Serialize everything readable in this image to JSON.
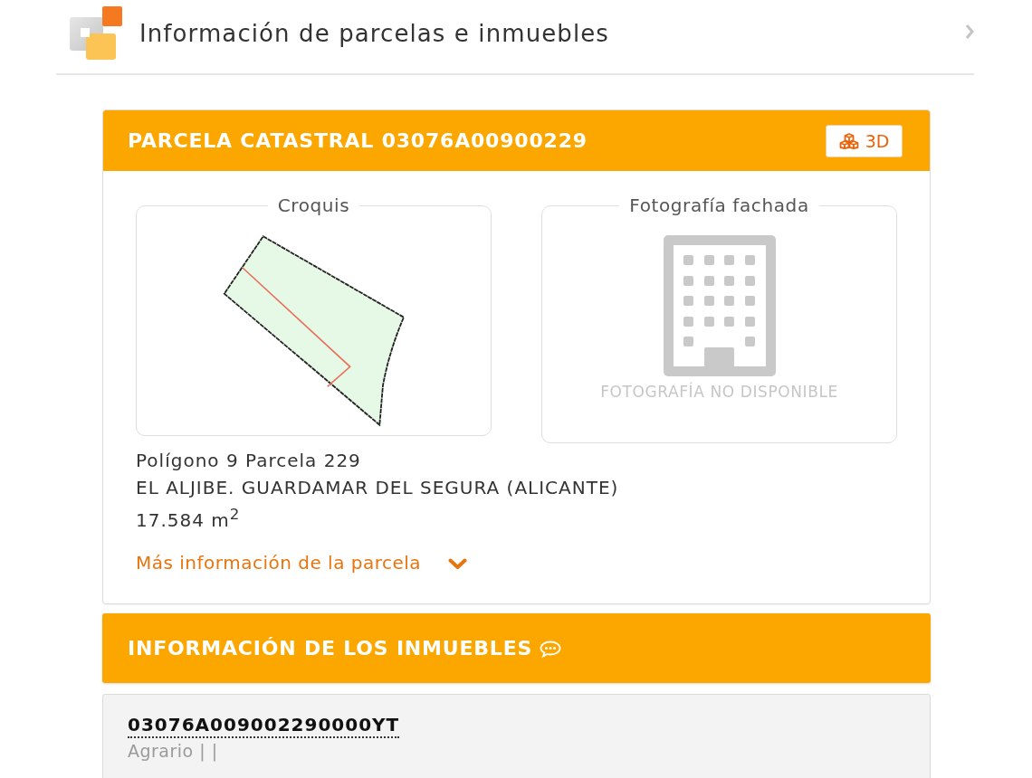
{
  "header": {
    "title": "Información de parcelas e inmuebles"
  },
  "parcel": {
    "title": "PARCELA CATASTRAL 03076A00900229",
    "view_3d_button": "3D",
    "sketch": {
      "legend": "Croquis"
    },
    "facade_photo": {
      "legend": "Fotografía fachada",
      "notice": "FOTOGRAFÍA NO DISPONIBLE"
    },
    "details": [
      "Polígono 9 Parcela 229",
      "EL ALJIBE. GUARDAMAR DEL SEGURA (ALICANTE)",
      "17.584 m$^{2}$"
    ],
    "more_info": {
      "label": "Más información de la parcela",
      "expanded": false
    }
  },
  "properties": {
    "title": "INFORMACIÓN DE LOS INMUEBLES",
    "items": [
      {
        "reference": "03076A009002290000YT",
        "use": "Agrario | |"
      }
    ]
  }
}
